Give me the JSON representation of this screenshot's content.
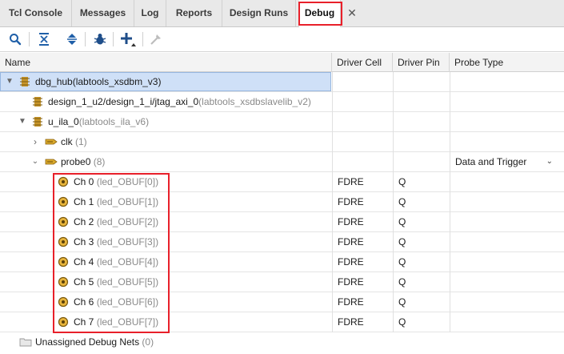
{
  "tabs": [
    {
      "label": "Tcl Console"
    },
    {
      "label": "Messages"
    },
    {
      "label": "Log"
    },
    {
      "label": "Reports"
    },
    {
      "label": "Design Runs"
    },
    {
      "label": "Debug"
    }
  ],
  "active_tab": "Debug",
  "close_glyph": "✕",
  "toolbar": {
    "buttons": [
      "search-icon",
      "collapse-all-icon",
      "expand-all-icon",
      "debug-icon",
      "add-icon",
      "disabled-action-icon"
    ]
  },
  "columns": {
    "name": "Name",
    "driver_cell": "Driver Cell",
    "driver_pin": "Driver Pin",
    "probe_type": "Probe Type"
  },
  "tree": {
    "dbg_hub": {
      "label": "dbg_hub",
      "suffix": "(labtools_xsdbm_v3)"
    },
    "design": {
      "label": "design_1_u2/design_1_i/jtag_axi_0",
      "suffix": "(labtools_xsdbslavelib_v2)"
    },
    "u_ila": {
      "label": "u_ila_0",
      "suffix": "(labtools_ila_v6)"
    },
    "clk": {
      "label": "clk",
      "suffix": "(1)"
    },
    "probe0": {
      "label": "probe0",
      "suffix": "(8)",
      "probe_type": "Data and Trigger"
    },
    "channels": [
      {
        "label": "Ch 0",
        "net": "(led_OBUF[0])",
        "driver_cell": "FDRE",
        "driver_pin": "Q"
      },
      {
        "label": "Ch 1",
        "net": "(led_OBUF[1])",
        "driver_cell": "FDRE",
        "driver_pin": "Q"
      },
      {
        "label": "Ch 2",
        "net": "(led_OBUF[2])",
        "driver_cell": "FDRE",
        "driver_pin": "Q"
      },
      {
        "label": "Ch 3",
        "net": "(led_OBUF[3])",
        "driver_cell": "FDRE",
        "driver_pin": "Q"
      },
      {
        "label": "Ch 4",
        "net": "(led_OBUF[4])",
        "driver_cell": "FDRE",
        "driver_pin": "Q"
      },
      {
        "label": "Ch 5",
        "net": "(led_OBUF[5])",
        "driver_cell": "FDRE",
        "driver_pin": "Q"
      },
      {
        "label": "Ch 6",
        "net": "(led_OBUF[6])",
        "driver_cell": "FDRE",
        "driver_pin": "Q"
      },
      {
        "label": "Ch 7",
        "net": "(led_OBUF[7])",
        "driver_cell": "FDRE",
        "driver_pin": "Q"
      }
    ],
    "unassigned": {
      "label": "Unassigned Debug Nets",
      "suffix": "(0)"
    }
  },
  "colors": {
    "highlight_box": "#e8202a",
    "selection": "#cfe0f7"
  }
}
